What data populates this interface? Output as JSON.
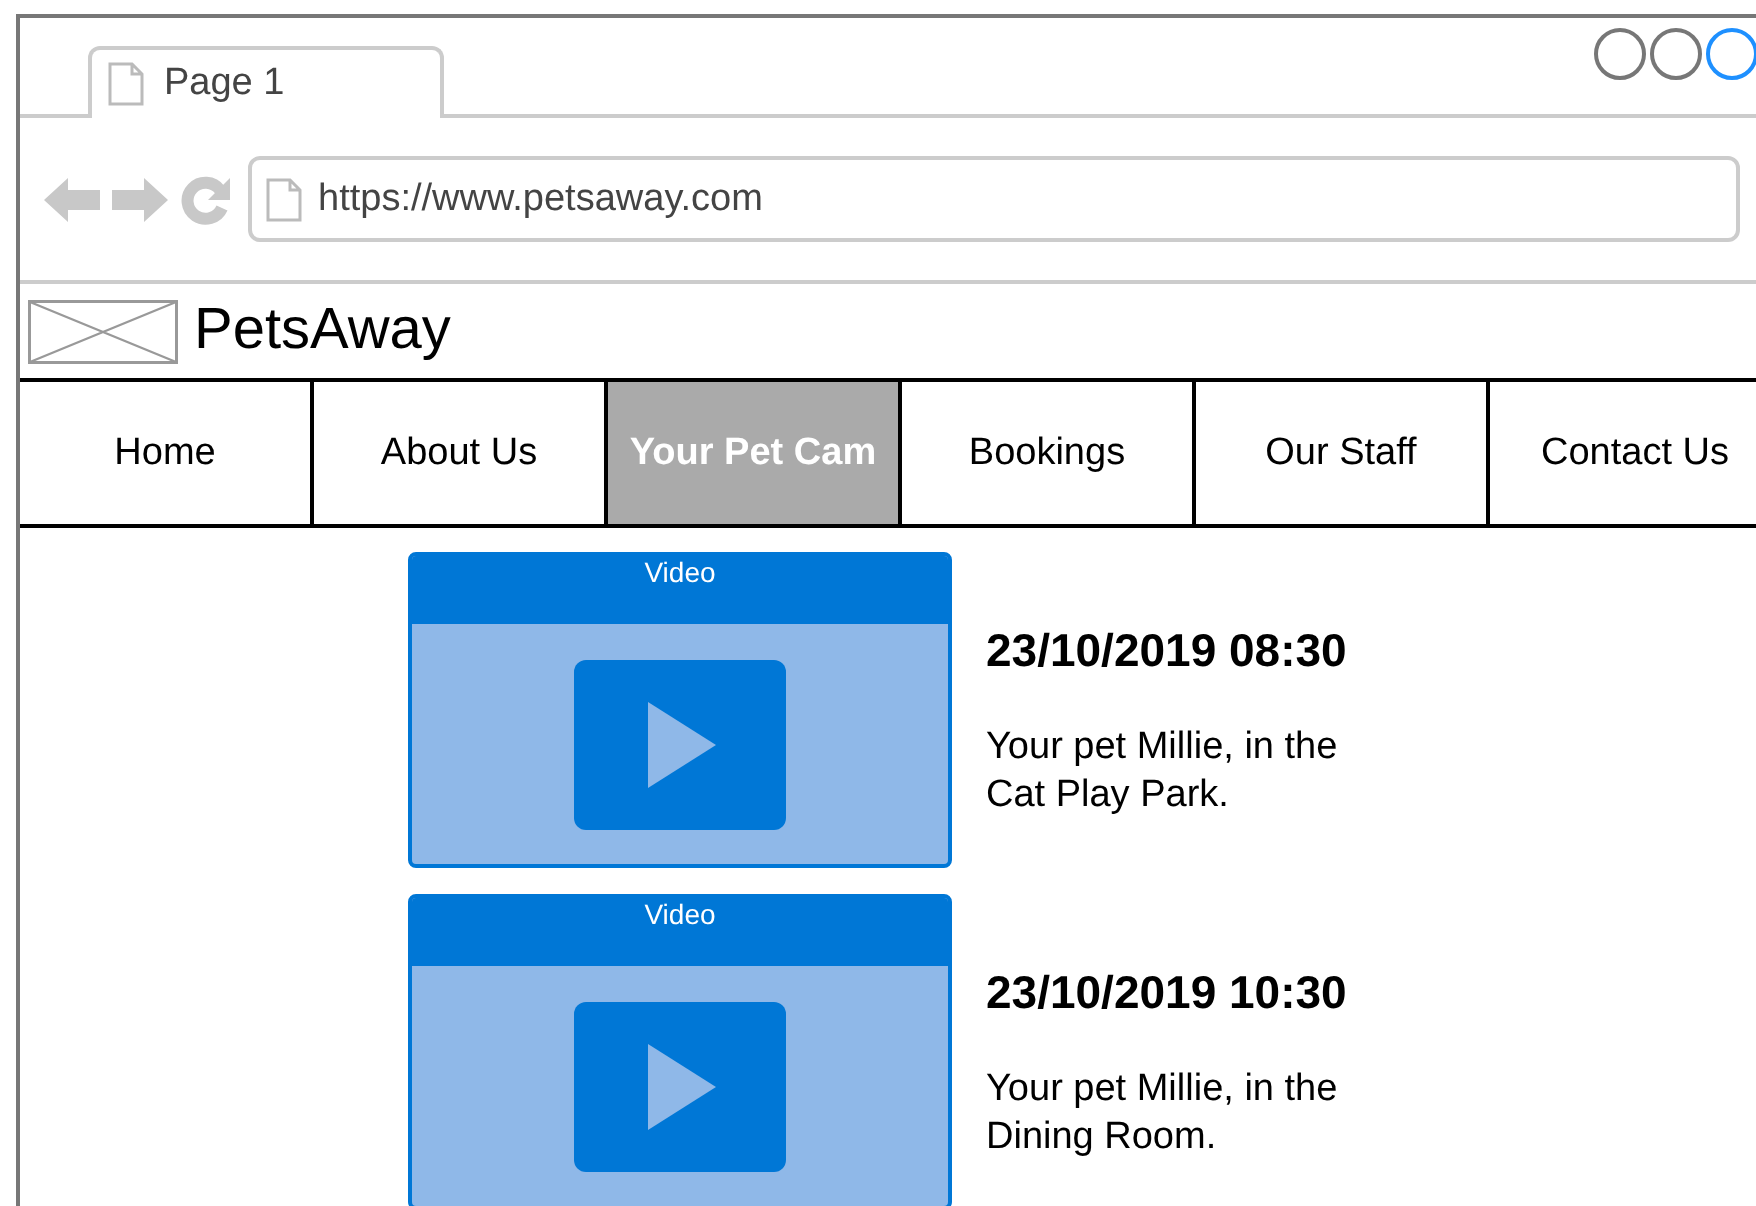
{
  "browser": {
    "tab": {
      "title": "Page 1"
    },
    "address": {
      "value": "https://www.petsaway.com"
    }
  },
  "site": {
    "name": "PetsAway"
  },
  "nav": [
    {
      "label": "Home",
      "selected": false
    },
    {
      "label": "About Us",
      "selected": false
    },
    {
      "label": "Your Pet Cam",
      "selected": true
    },
    {
      "label": "Bookings",
      "selected": false
    },
    {
      "label": "Our Staff",
      "selected": false
    },
    {
      "label": "Contact Us",
      "selected": false
    }
  ],
  "videos": [
    {
      "label": "Video",
      "time": "23/10/2019 08:30",
      "caption": "Your pet Millie, in the Cat Play Park."
    },
    {
      "label": "Video",
      "time": "23/10/2019 10:30",
      "caption": "Your pet Millie, in the Dining Room."
    }
  ]
}
